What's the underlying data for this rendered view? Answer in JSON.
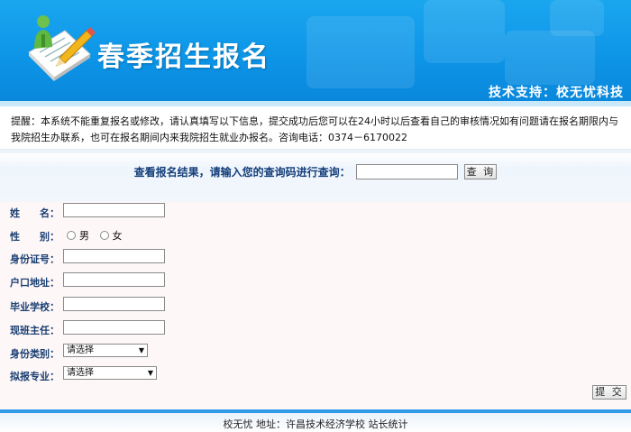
{
  "header": {
    "title": "春季招生报名",
    "support": "技术支持：校无忧科技"
  },
  "notice": "提醒：本系统不能重复报名或修改，请认真填写以下信息，提交成功后您可以在24小时以后查看自己的审核情况如有问题请在报名期限内与我院招生办联系，也可在报名期间内来我院招生就业办报名。咨询电话：0374－6170022",
  "query": {
    "label": "查看报名结果，请输入您的查询码进行查询：",
    "input_value": "",
    "button_label": "查 询"
  },
  "form": {
    "name_label": "姓　　名：",
    "gender_label": "性　　别：",
    "gender_options": [
      "男",
      "女"
    ],
    "id_label": "身份证号：",
    "address_label": "户口地址：",
    "school_label": "毕业学校：",
    "teacher_label": "现班主任：",
    "identity_label": "身份类别：",
    "identity_value": "请选择",
    "major_label": "拟报专业：",
    "major_value": "请选择",
    "submit_label": "提 交"
  },
  "footer": {
    "text": "校无忧 地址：许昌技术经济学校 站长统计"
  }
}
